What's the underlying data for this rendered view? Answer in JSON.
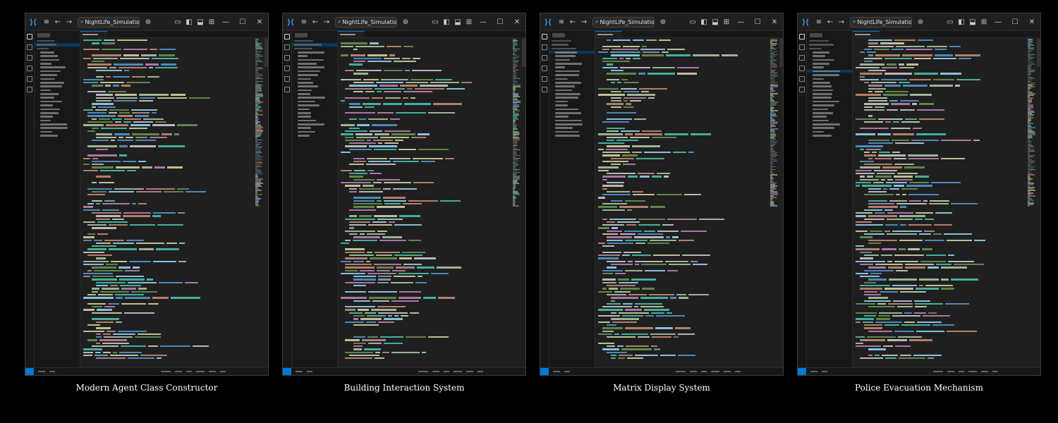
{
  "panels": [
    {
      "caption": "Modern Agent Class Constructor",
      "window": {
        "search_text": "NightLife_Simulatio",
        "active_file_row": 1
      }
    },
    {
      "caption": "Building Interaction System",
      "window": {
        "search_text": "NightLife_Simulatio",
        "active_file_row": 1
      }
    },
    {
      "caption": "Matrix Display System",
      "window": {
        "search_text": "NightLife_Simulatio",
        "active_file_row": 3
      }
    },
    {
      "caption": "Police Evacuation Mechanism",
      "window": {
        "search_text": "NightLife_Simulatio",
        "active_file_row": 8
      }
    }
  ],
  "icons": {
    "app": "vscode-logo-icon",
    "menu": "hamburger-menu-icon",
    "back": "arrow-left-icon",
    "forward": "arrow-right-icon",
    "search": "search-icon",
    "copilot": "copilot-icon",
    "layout": "layout-icons",
    "minimize": "minimize-icon",
    "maximize": "maximize-icon",
    "close": "close-icon"
  },
  "colors": {
    "background": "#000000",
    "editor": "#1f1f1f",
    "sidebar": "#181818",
    "accent": "#0078d4",
    "selection": "#04395e",
    "caption": "#ffffff"
  }
}
